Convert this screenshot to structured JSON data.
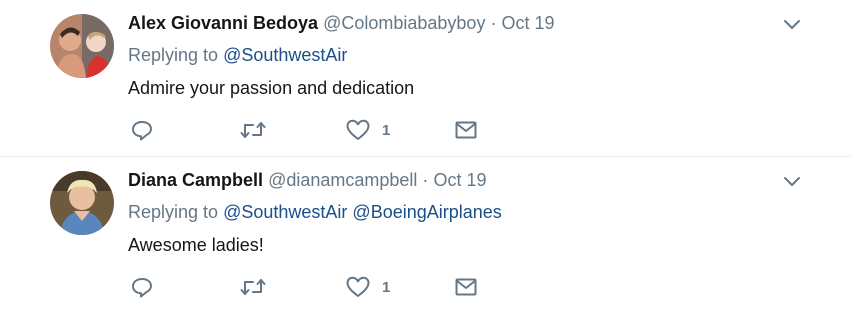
{
  "tweets": [
    {
      "author": "Alex Giovanni Bedoya",
      "handle": "@Colombiababyboy",
      "separator": "·",
      "date": "Oct 19",
      "replying_prefix": "Replying to",
      "replying_to": [
        "@SouthwestAir"
      ],
      "text": "Admire your passion and dedication",
      "likes": "1"
    },
    {
      "author": "Diana Campbell",
      "handle": "@dianamcampbell",
      "separator": "·",
      "date": "Oct 19",
      "replying_prefix": "Replying to",
      "replying_to": [
        "@SouthwestAir",
        "@BoeingAirplanes"
      ],
      "text": "Awesome ladies!",
      "likes": "1"
    }
  ],
  "icons": {
    "reply": "reply-icon",
    "retweet": "retweet-icon",
    "like": "heart-icon",
    "dm": "envelope-icon",
    "menu": "chevron-down-icon"
  },
  "colors": {
    "text": "#14171a",
    "secondary": "#657786",
    "mention": "#1b4f8a",
    "divider": "#e6ecf0"
  }
}
